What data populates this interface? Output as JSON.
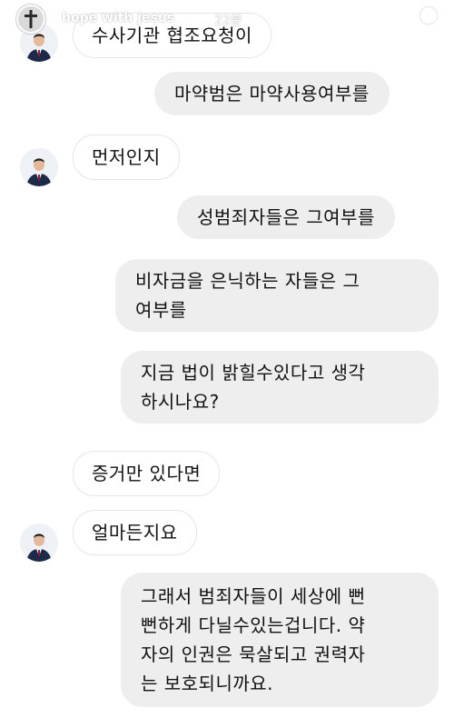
{
  "story": {
    "username": "hope with jesus",
    "time": "22분"
  },
  "messages": [
    {
      "side": "in",
      "lines": [
        "수사기관 협조요청이"
      ]
    },
    {
      "side": "out",
      "lines": [
        "마약범은 마약사용여부를"
      ]
    },
    {
      "side": "in",
      "lines": [
        "먼저인지"
      ]
    },
    {
      "side": "out",
      "lines": [
        "성범죄자들은 그여부를"
      ]
    },
    {
      "side": "out",
      "lines": [
        "비자금을 은닉하는 자들은 그",
        "여부를"
      ]
    },
    {
      "side": "out",
      "lines": [
        "지금 법이 밝힐수있다고 생각",
        "하시나요?"
      ]
    },
    {
      "side": "in",
      "lines": [
        "증거만 있다면"
      ]
    },
    {
      "side": "in",
      "lines": [
        "얼마든지요"
      ]
    },
    {
      "side": "out",
      "lines": [
        "그래서 범죄자들이 세상에 뻔",
        "뻔하게 다닐수있는겁니다. 약",
        "자의 인권은 묵살되고 권력자",
        "는 보호되니까요."
      ]
    }
  ]
}
